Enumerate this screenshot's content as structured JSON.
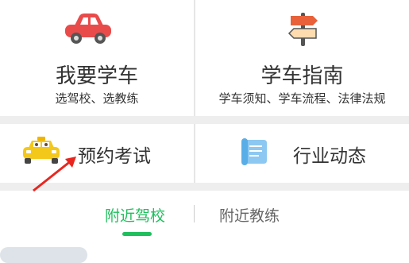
{
  "grid": {
    "learn": {
      "title": "我要学车",
      "subtitle": "选驾校、选教练",
      "icon": "car-icon"
    },
    "guide": {
      "title": "学车指南",
      "subtitle": "学车须知、学车流程、法律法规",
      "icon": "signpost-icon"
    },
    "exam": {
      "label": "预约考试",
      "icon": "taxi-icon"
    },
    "news": {
      "label": "行业动态",
      "icon": "scroll-icon"
    }
  },
  "tabs": [
    {
      "label": "附近驾校",
      "active": true
    },
    {
      "label": "附近教练",
      "active": false
    }
  ],
  "colors": {
    "accent": "#1fbf5d",
    "car": "#e94b4b",
    "arrow": "#e8261f"
  }
}
